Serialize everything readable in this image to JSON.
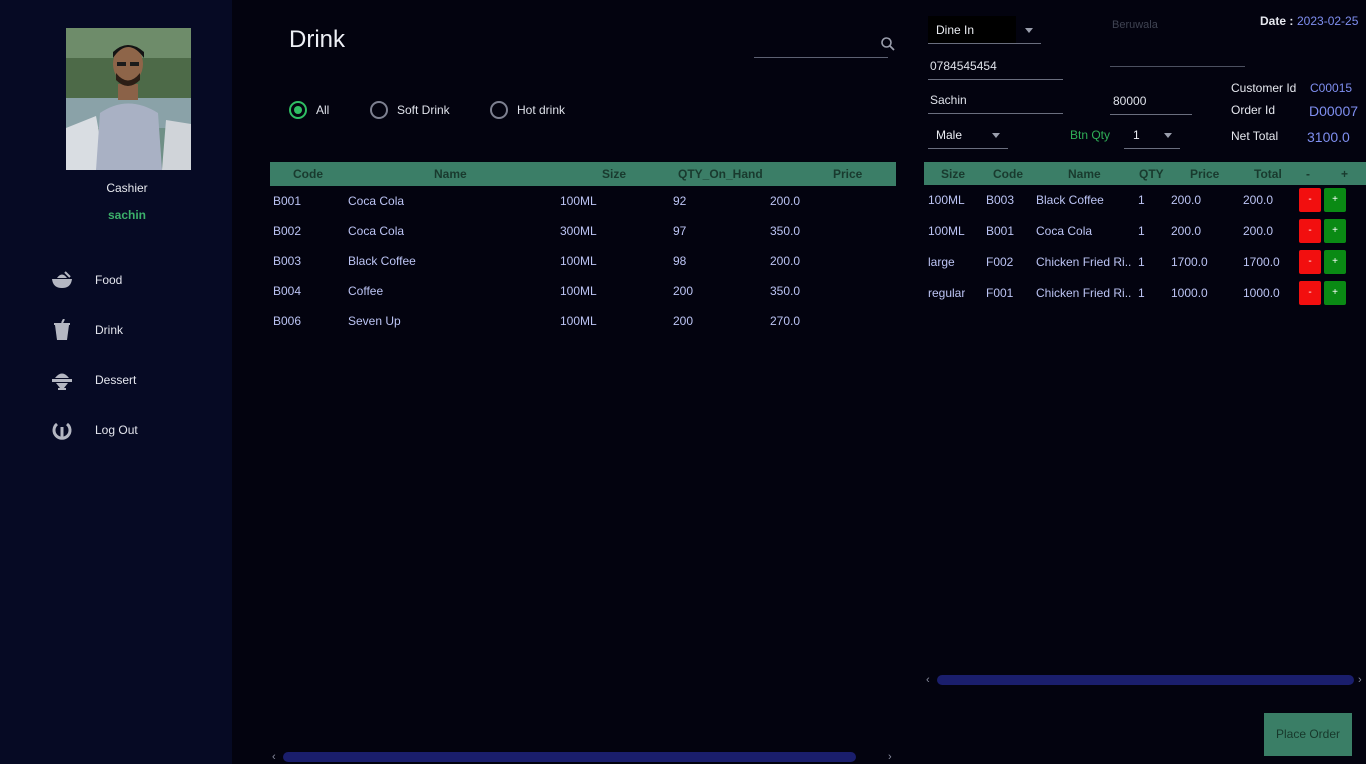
{
  "sidebar": {
    "role": "Cashier",
    "username": "sachin",
    "nav": [
      {
        "label": "Food",
        "icon": "food-bowl-icon"
      },
      {
        "label": "Drink",
        "icon": "drink-cup-icon"
      },
      {
        "label": "Dessert",
        "icon": "dessert-icon"
      },
      {
        "label": "Log Out",
        "icon": "logout-icon"
      }
    ]
  },
  "main": {
    "title": "Drink",
    "search": {
      "value": "",
      "placeholder": ""
    },
    "filters": [
      {
        "label": "All",
        "selected": true
      },
      {
        "label": "Soft Drink",
        "selected": false
      },
      {
        "label": "Hot drink",
        "selected": false
      }
    ],
    "columns": [
      "Code",
      "Name",
      "Size",
      "QTY_On_Hand",
      "Price"
    ],
    "rows": [
      [
        "B001",
        "Coca Cola",
        "100ML",
        "92",
        "200.0"
      ],
      [
        "B002",
        "Coca Cola",
        "300ML",
        "97",
        "350.0"
      ],
      [
        "B003",
        "Black Coffee",
        "100ML",
        "98",
        "200.0"
      ],
      [
        "B004",
        "Coffee",
        "100ML",
        "200",
        "350.0"
      ],
      [
        "B006",
        "Seven Up",
        "100ML",
        "200",
        "270.0"
      ]
    ]
  },
  "order": {
    "date_label": "Date :",
    "date_value": "2023-02-25",
    "order_type": "Dine In",
    "city_placeholder": "Beruwala",
    "phone": "0784545454",
    "name": "Sachin",
    "amount": "80000",
    "gender": "Male",
    "btn_qty_label": "Btn Qty",
    "btn_qty_value": "1",
    "customer_id_label": "Customer Id",
    "customer_id": "C00015",
    "order_id_label": "Order Id",
    "order_id": "D00007",
    "net_total_label": "Net Total",
    "net_total": "3100.0",
    "columns": [
      "Size",
      "Code",
      "Name",
      "QTY",
      "Price",
      "Total",
      "-",
      "+"
    ],
    "items": [
      [
        "100ML",
        "B003",
        "Black Coffee",
        "1",
        "200.0",
        "200.0"
      ],
      [
        "100ML",
        "B001",
        "Coca Cola",
        "1",
        "200.0",
        "200.0"
      ],
      [
        "large",
        "F002",
        "Chicken Fried Ri...",
        "1",
        "1700.0",
        "1700.0"
      ],
      [
        "regular",
        "F001",
        "Chicken Fried Ri...",
        "1",
        "1000.0",
        "1000.0"
      ]
    ],
    "minus_label": "-",
    "plus_label": "+",
    "place_order": "Place Order"
  },
  "colors": {
    "accent_green": "#3b7e67",
    "selected_green": "#2fbe63",
    "minus_red": "#f20f0f",
    "plus_green": "#0a8a14"
  }
}
